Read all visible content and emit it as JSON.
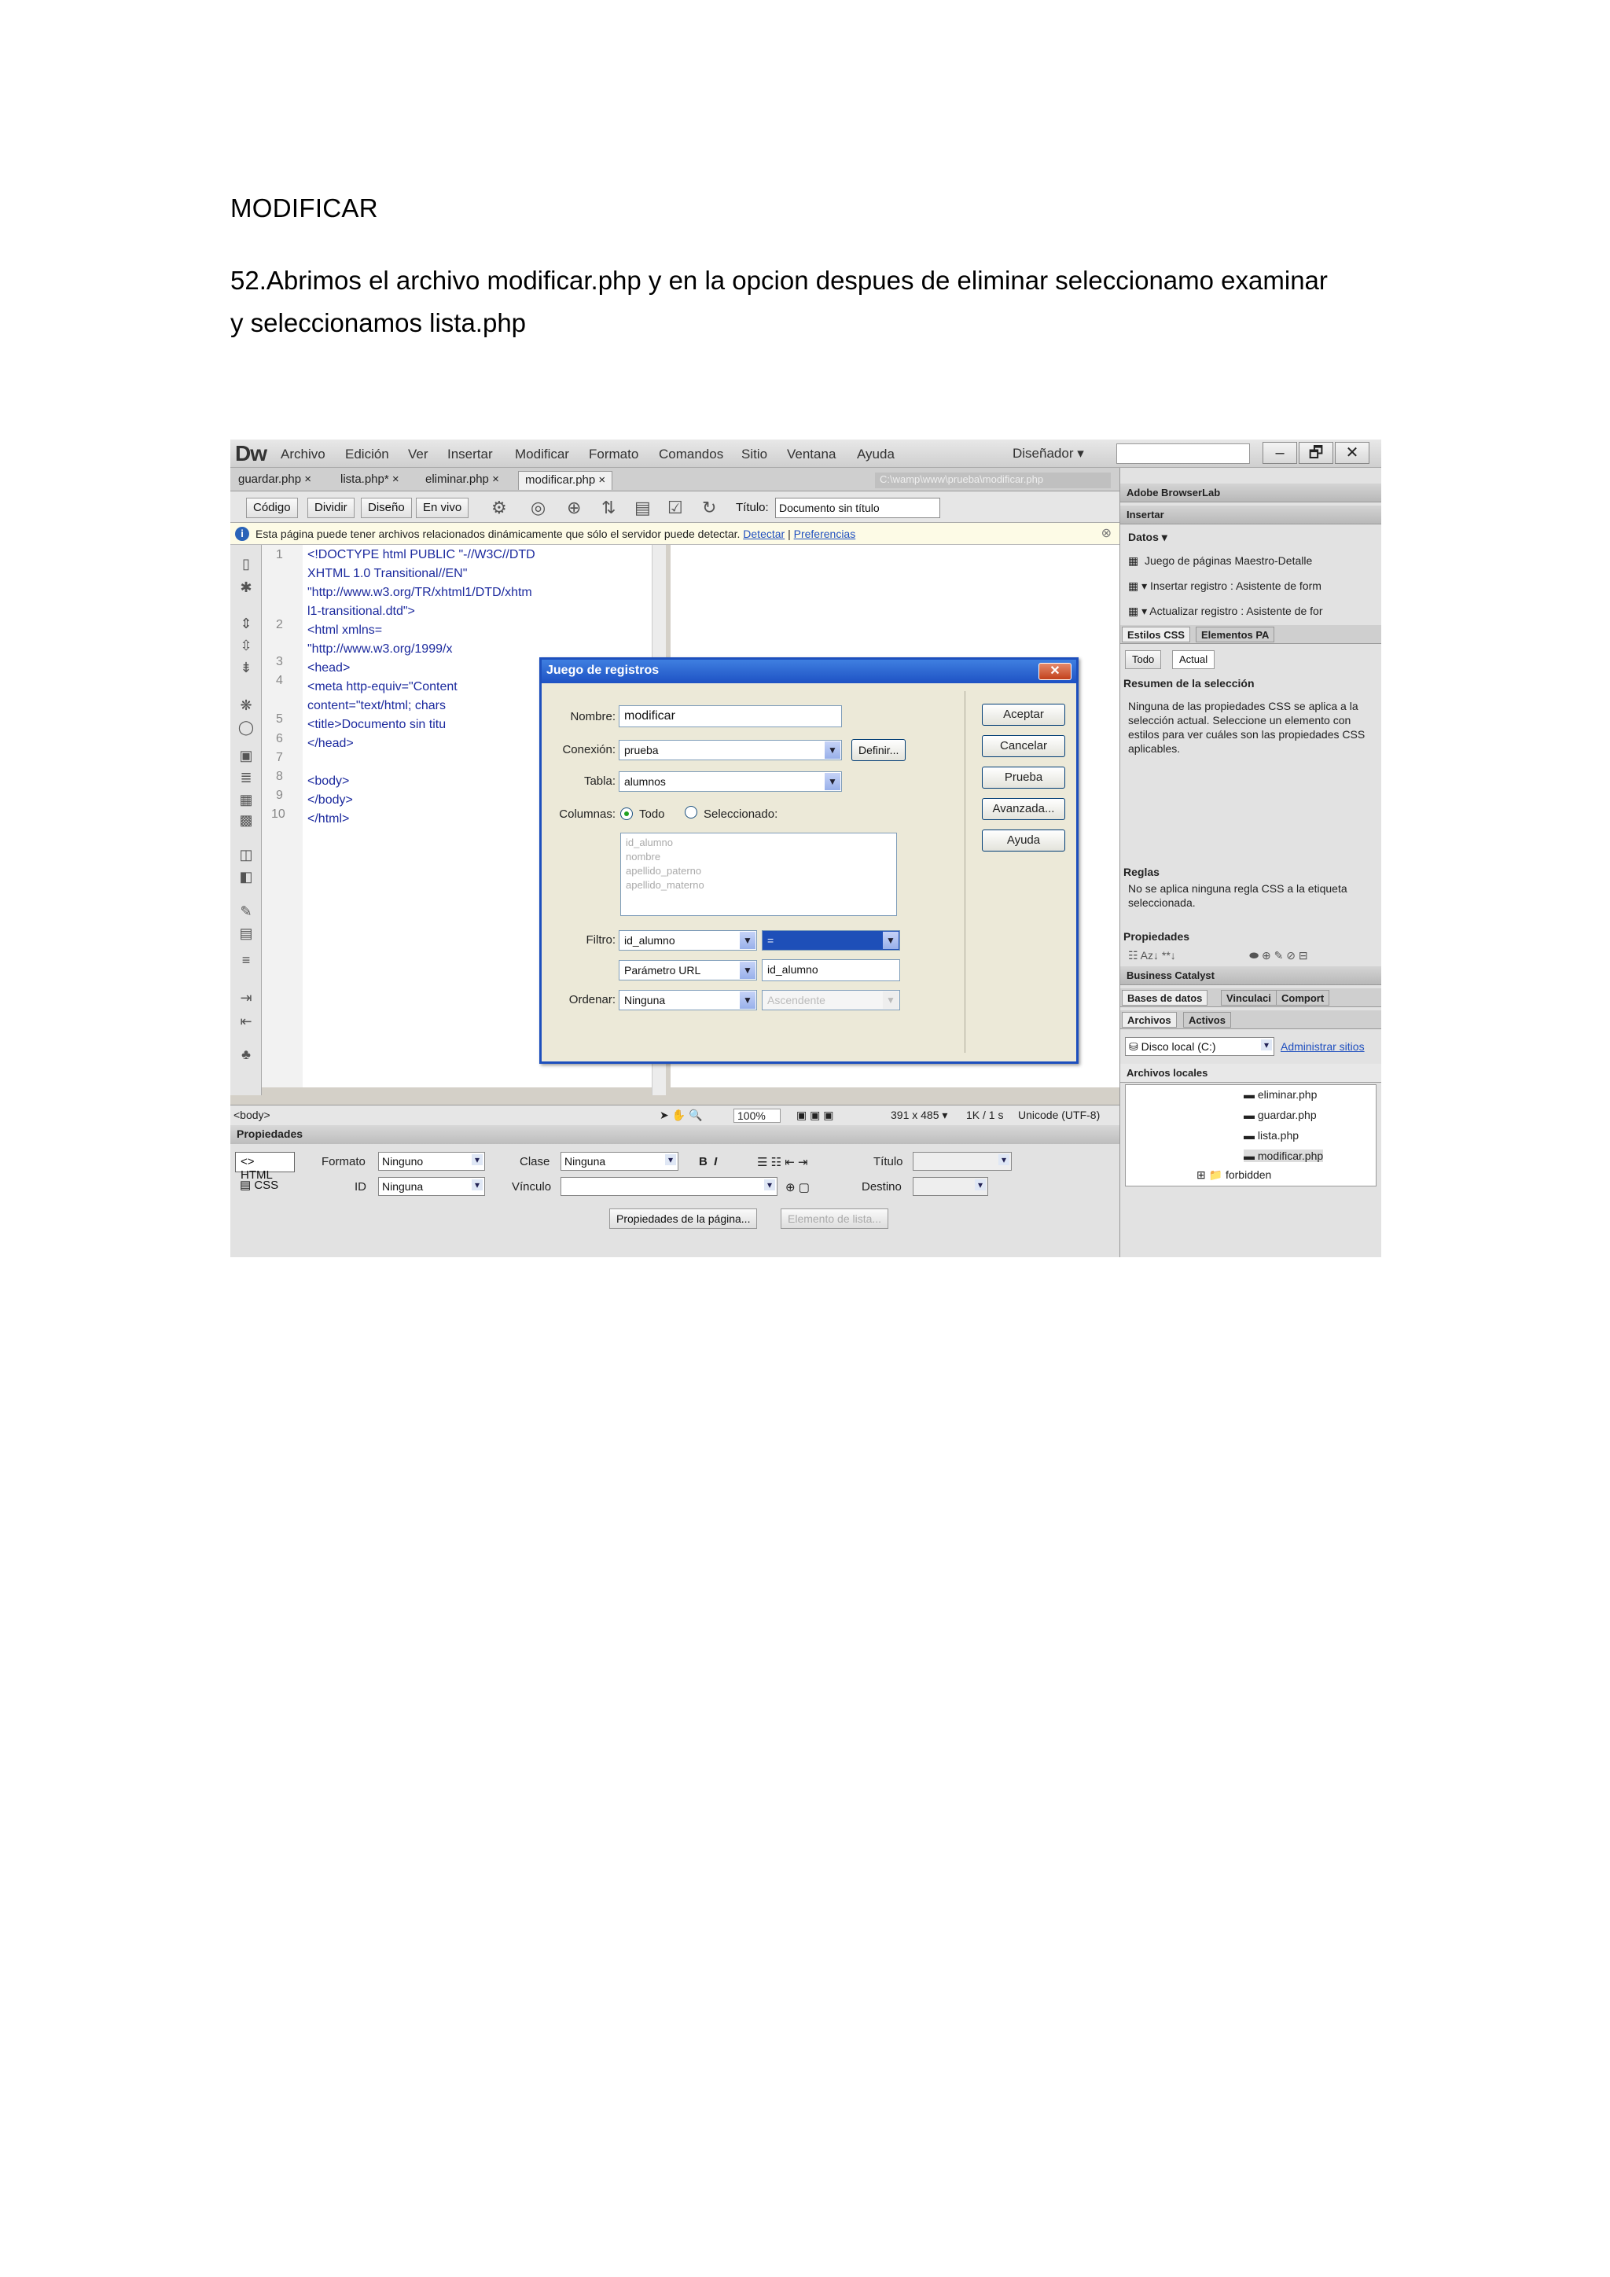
{
  "doc": {
    "heading": "MODIFICAR",
    "paragraph": "52.Abrimos el archivo modificar.php y en la opcion despues de eliminar seleccionamo examinar y seleccionamos lista.php"
  },
  "app": {
    "logo": "Dw",
    "menu": [
      "Archivo",
      "Edición",
      "Ver",
      "Insertar",
      "Modificar",
      "Formato",
      "Comandos",
      "Sitio",
      "Ventana",
      "Ayuda"
    ],
    "workspace": "Diseñador ▾",
    "window_buttons": [
      "–",
      "🗗",
      "✕"
    ]
  },
  "tabs": {
    "items": [
      "guardar.php",
      "lista.php*",
      "eliminar.php",
      "modificar.php"
    ],
    "close": "×",
    "path": "C:\\wamp\\www\\prueba\\modificar.php"
  },
  "viewbar": {
    "buttons": [
      "Código",
      "Dividir",
      "Diseño",
      "En vivo"
    ],
    "title_label": "Título:",
    "title_value": "Documento sin título"
  },
  "infobar": {
    "text": "Esta página puede tener archivos relacionados dinámicamente que sólo el servidor puede detectar.",
    "link1": "Detectar",
    "sep": " | ",
    "link2": "Preferencias"
  },
  "code": {
    "line_numbers": [
      "1",
      "2",
      "3",
      "4",
      "5",
      "6",
      "7",
      "8",
      "9",
      "10"
    ],
    "lines": [
      "<!DOCTYPE html PUBLIC \"-//W3C//DTD",
      "XHTML 1.0 Transitional//EN\"",
      "\"http://www.w3.org/TR/xhtml1/DTD/xhtm",
      "l1-transitional.dtd\">",
      "<html xmlns=",
      "\"http://www.w3.org/1999/x",
      "<head>",
      "<meta http-equiv=\"Content",
      "content=\"text/html; chars",
      "<title>Documento sin titu",
      "</head>",
      "",
      "<body>",
      "</body>",
      "</html>"
    ]
  },
  "statusbar": {
    "tag": "<body>",
    "zoom": "100%",
    "size": "391 x 485 ▾",
    "weight": "1K / 1 s",
    "encoding": "Unicode (UTF-8)"
  },
  "properties": {
    "title": "Propiedades",
    "html_label": "HTML",
    "css_label": "CSS",
    "formato_label": "Formato",
    "formato_value": "Ninguno",
    "id_label": "ID",
    "id_value": "Ninguna",
    "clase_label": "Clase",
    "clase_value": "Ninguna",
    "vinculo_label": "Vínculo",
    "titulo_label": "Título",
    "destino_label": "Destino",
    "page_props_button": "Propiedades de la página...",
    "list_item_button": "Elemento de lista..."
  },
  "dialog": {
    "title": "Juego de registros",
    "nombre_label": "Nombre:",
    "nombre_value": "modificar",
    "conexion_label": "Conexión:",
    "conexion_value": "prueba",
    "definir_button": "Definir...",
    "tabla_label": "Tabla:",
    "tabla_value": "alumnos",
    "columnas_label": "Columnas:",
    "todo_label": "Todo",
    "seleccionado_label": "Seleccionado:",
    "columns": [
      "id_alumno",
      "nombre",
      "apellido_paterno",
      "apellido_materno"
    ],
    "filtro_label": "Filtro:",
    "filtro_value": "id_alumno",
    "filtro_op": "=",
    "param_type": "Parámetro URL",
    "param_value": "id_alumno",
    "ordenar_label": "Ordenar:",
    "ordenar_value": "Ninguna",
    "orden_dir": "Ascendente",
    "buttons": [
      "Aceptar",
      "Cancelar",
      "Prueba",
      "Avanzada...",
      "Ayuda"
    ]
  },
  "rightpanel": {
    "browserlab": "Adobe BrowserLab",
    "insertar": "Insertar",
    "datos": "Datos ▾",
    "insert_items": [
      "Juego de páginas Maestro-Detalle",
      "▾ Insertar registro : Asistente de form",
      "▾ Actualizar registro : Asistente de for"
    ],
    "css_tab": "Estilos CSS",
    "ap_tab": "Elementos PA",
    "todo_btn": "Todo",
    "actual_btn": "Actual",
    "resumen_title": "Resumen de la selección",
    "resumen_text": "Ninguna de las propiedades CSS se aplica a la selección actual. Seleccione un elemento con estilos para ver cuáles son las propiedades CSS aplicables.",
    "reglas_title": "Reglas",
    "reglas_text": "No se aplica ninguna regla CSS a la etiqueta seleccionada.",
    "propiedades_title": "Propiedades",
    "business": "Business Catalyst",
    "bases": "Bases de datos",
    "vinculaciones": "Vinculaci",
    "comport": "Comport",
    "archivos_tab": "Archivos",
    "activos_tab": "Activos",
    "disco": "Disco local (C:)",
    "administrar": "Administrar sitios",
    "archivos_locales": "Archivos locales",
    "files": [
      "eliminar.php",
      "guardar.php",
      "lista.php",
      "modificar.php",
      "forbidden"
    ]
  },
  "colors": {
    "dialog_title": "#1e52c4",
    "code_text": "#1c2a9e",
    "link": "#1f4fbf"
  }
}
